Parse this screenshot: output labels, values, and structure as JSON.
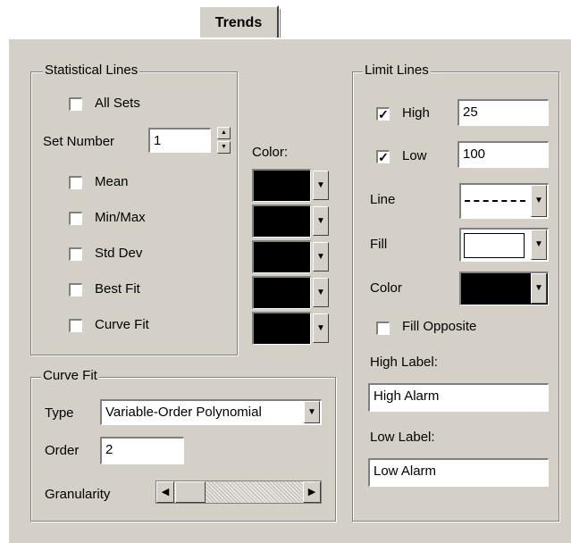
{
  "tab": {
    "label": "Trends"
  },
  "statistical_lines": {
    "title": "Statistical Lines",
    "all_sets": {
      "label": "All Sets",
      "checked": false
    },
    "set_number": {
      "label": "Set Number",
      "value": "1"
    },
    "color_label": "Color:",
    "lines": [
      {
        "label": "Mean",
        "checked": false,
        "color": "#000000"
      },
      {
        "label": "Min/Max",
        "checked": false,
        "color": "#000000"
      },
      {
        "label": "Std Dev",
        "checked": false,
        "color": "#000000"
      },
      {
        "label": "Best Fit",
        "checked": false,
        "color": "#000000"
      },
      {
        "label": "Curve Fit",
        "checked": false,
        "color": "#000000"
      }
    ]
  },
  "curve_fit": {
    "title": "Curve Fit",
    "type_label": "Type",
    "type_value": "Variable-Order Polynomial",
    "order_label": "Order",
    "order_value": "2",
    "granularity_label": "Granularity"
  },
  "limit_lines": {
    "title": "Limit Lines",
    "high": {
      "label": "High",
      "checked": true,
      "value": "25"
    },
    "low": {
      "label": "Low",
      "checked": true,
      "value": "100"
    },
    "line_label": "Line",
    "fill_label": "Fill",
    "color_label": "Color",
    "fill_opposite": {
      "label": "Fill Opposite",
      "checked": false
    },
    "high_label_caption": "High Label:",
    "high_label_value": "High Alarm",
    "low_label_caption": "Low Label:",
    "low_label_value": "Low Alarm"
  },
  "colors": {
    "dialog_bg": "#d4d0c8",
    "swatch": "#000000",
    "fill_swatch": "#ffffff"
  }
}
